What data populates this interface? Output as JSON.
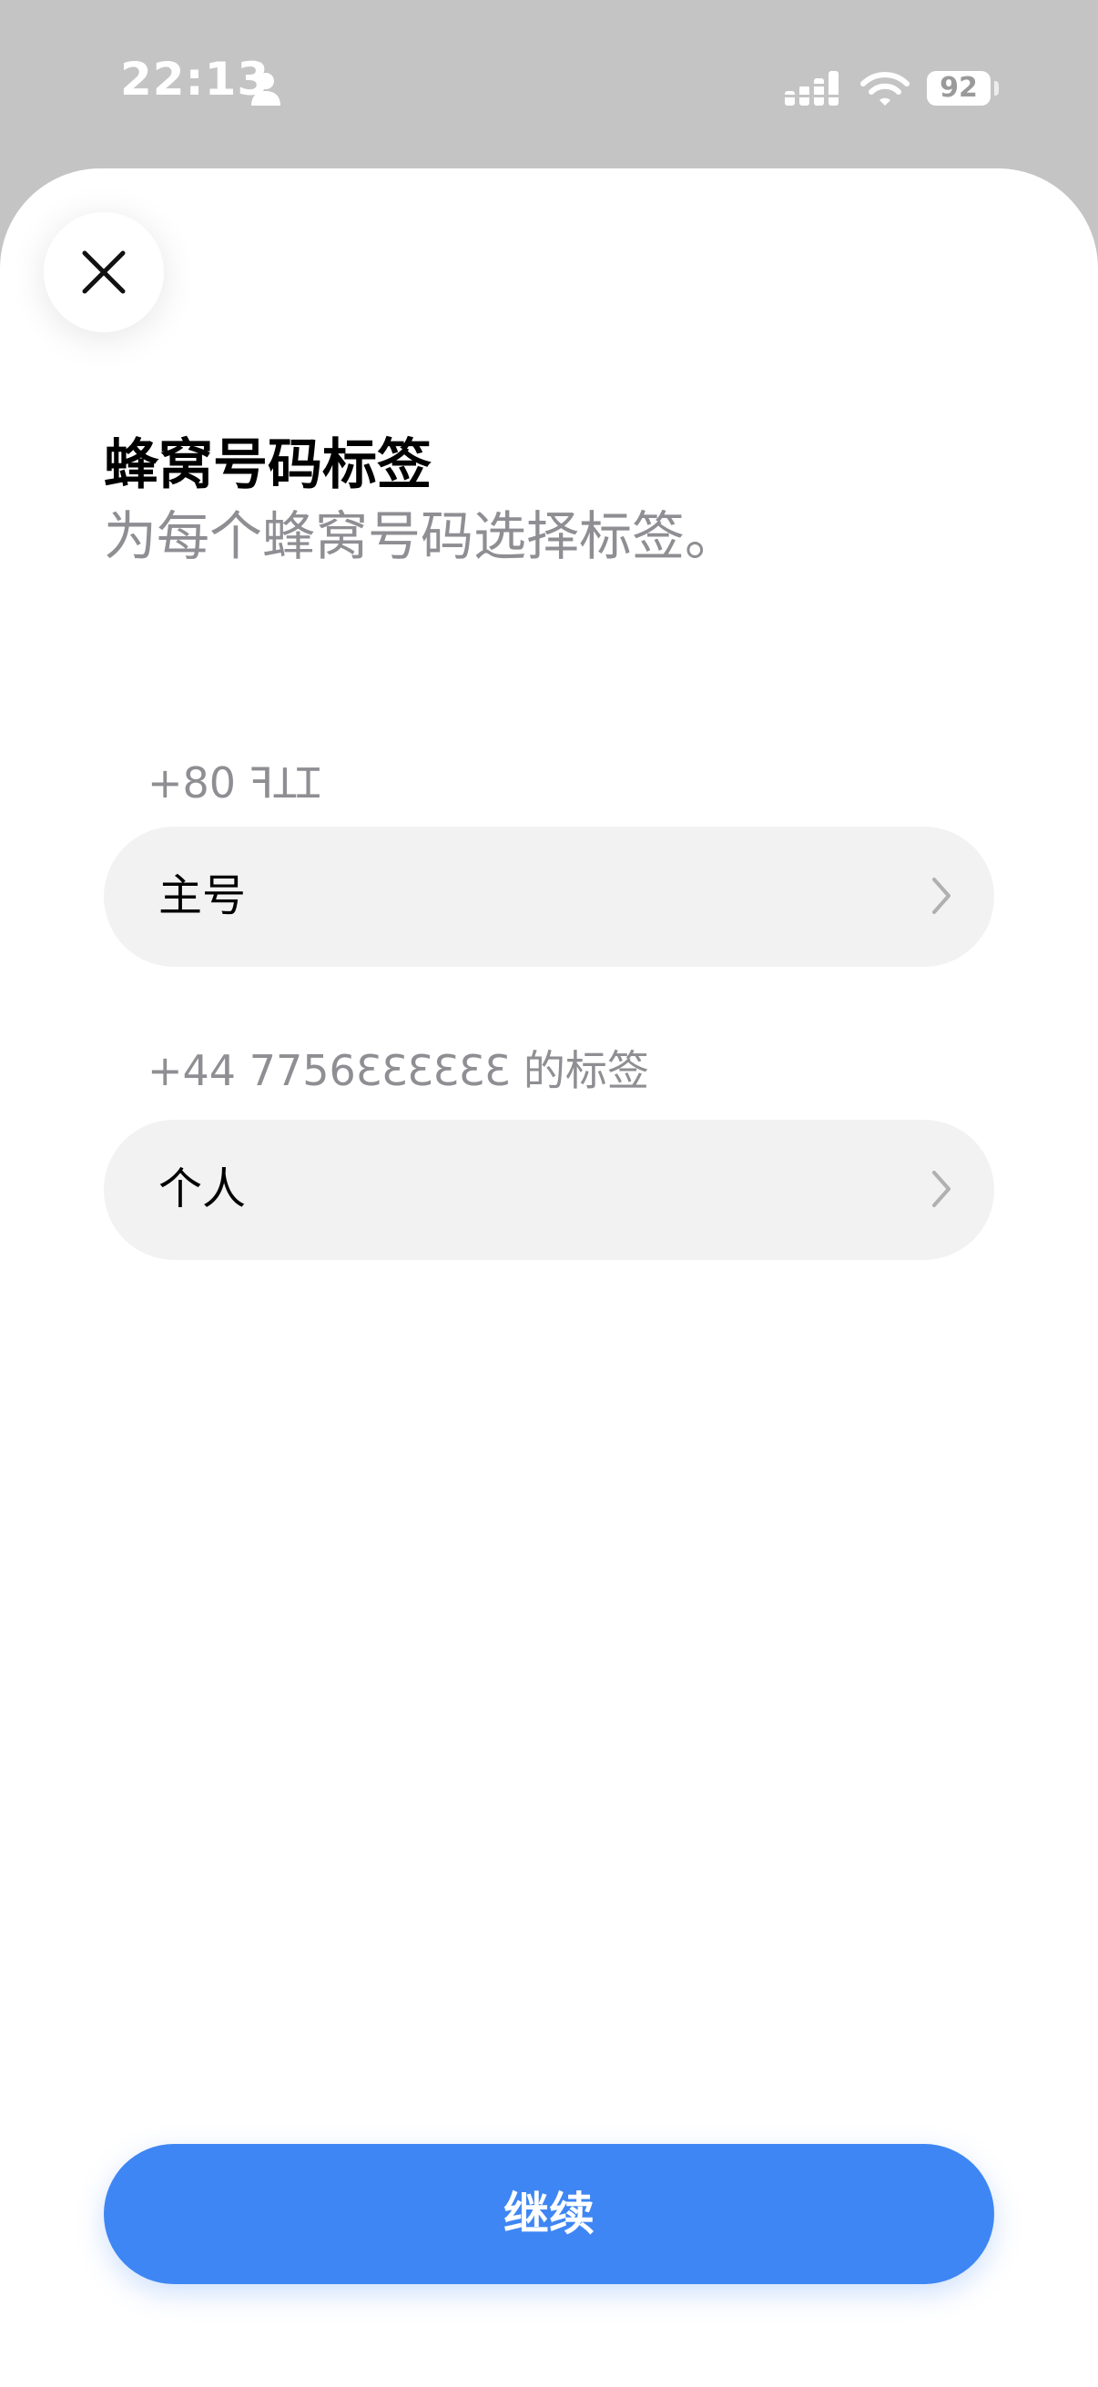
{
  "status_bar": {
    "time": "22:13",
    "battery": "92",
    "icons": [
      "person-icon",
      "cellular-signal-icon",
      "wifi-icon",
      "battery-icon"
    ]
  },
  "sheet": {
    "close_icon": "close-icon",
    "title": "蜂窝号码标签",
    "subtitle": "为每个蜂窝号码选择标签。",
    "lines": [
      {
        "number_label": "+80 ꟻꞱꞮ",
        "value": "主号",
        "chevron_icon": "chevron-right-icon"
      },
      {
        "number_label": "+44 7756ƐƐƐƐƐƐ 的标签",
        "value": "个人",
        "chevron_icon": "chevron-right-icon"
      }
    ],
    "continue_label": "继续"
  },
  "colors": {
    "accent": "#3e86f4",
    "row_background": "#f2f2f2",
    "secondary_text": "#8e8e93",
    "status_bar_background": "#c4c4c4"
  }
}
